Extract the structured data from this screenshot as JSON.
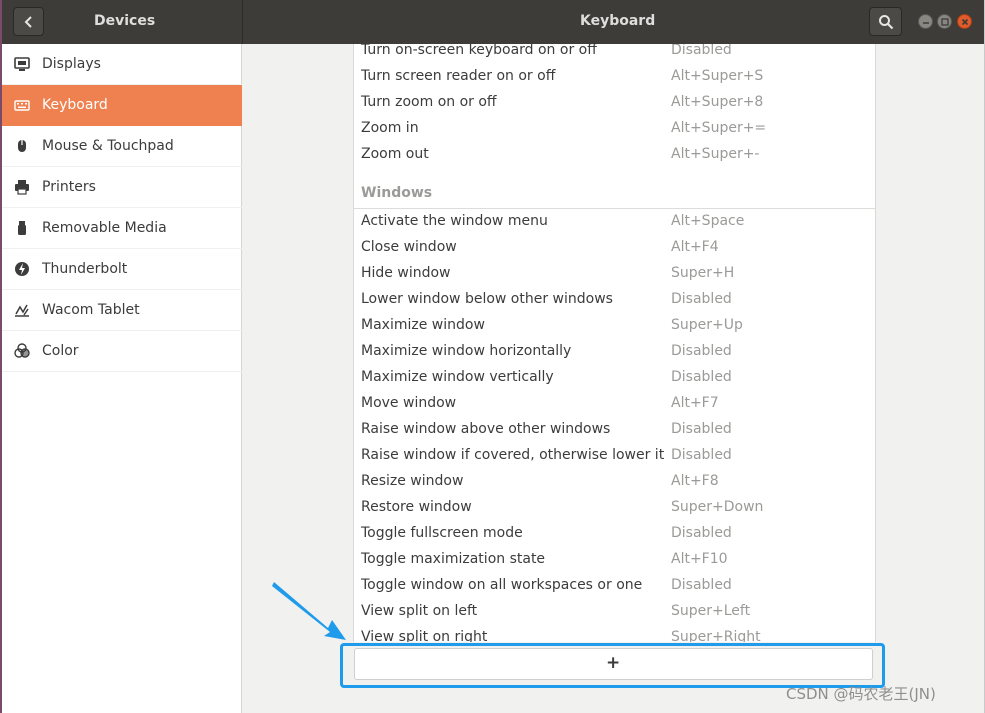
{
  "header": {
    "left_title": "Devices",
    "title": "Keyboard"
  },
  "sidebar": {
    "items": [
      {
        "label": "Displays",
        "icon": "display-icon",
        "active": false
      },
      {
        "label": "Keyboard",
        "icon": "keyboard-icon",
        "active": true
      },
      {
        "label": "Mouse & Touchpad",
        "icon": "mouse-icon",
        "active": false
      },
      {
        "label": "Printers",
        "icon": "printer-icon",
        "active": false
      },
      {
        "label": "Removable Media",
        "icon": "removable-media-icon",
        "active": false
      },
      {
        "label": "Thunderbolt",
        "icon": "thunderbolt-icon",
        "active": false
      },
      {
        "label": "Wacom Tablet",
        "icon": "tablet-icon",
        "active": false
      },
      {
        "label": "Color",
        "icon": "color-icon",
        "active": false
      }
    ]
  },
  "shortcuts": {
    "accessibility_rows": [
      {
        "name": "Turn on-screen keyboard on or off",
        "accel": "Disabled"
      },
      {
        "name": "Turn screen reader on or off",
        "accel": "Alt+Super+S"
      },
      {
        "name": "Turn zoom on or off",
        "accel": "Alt+Super+8"
      },
      {
        "name": "Zoom in",
        "accel": "Alt+Super+="
      },
      {
        "name": "Zoom out",
        "accel": "Alt+Super+-"
      }
    ],
    "windows_heading": "Windows",
    "windows_rows": [
      {
        "name": "Activate the window menu",
        "accel": "Alt+Space"
      },
      {
        "name": "Close window",
        "accel": "Alt+F4"
      },
      {
        "name": "Hide window",
        "accel": "Super+H"
      },
      {
        "name": "Lower window below other windows",
        "accel": "Disabled"
      },
      {
        "name": "Maximize window",
        "accel": "Super+Up"
      },
      {
        "name": "Maximize window horizontally",
        "accel": "Disabled"
      },
      {
        "name": "Maximize window vertically",
        "accel": "Disabled"
      },
      {
        "name": "Move window",
        "accel": "Alt+F7"
      },
      {
        "name": "Raise window above other windows",
        "accel": "Disabled"
      },
      {
        "name": "Raise window if covered, otherwise lower it",
        "accel": "Disabled"
      },
      {
        "name": "Resize window",
        "accel": "Alt+F8"
      },
      {
        "name": "Restore window",
        "accel": "Super+Down"
      },
      {
        "name": "Toggle fullscreen mode",
        "accel": "Disabled"
      },
      {
        "name": "Toggle maximization state",
        "accel": "Alt+F10"
      },
      {
        "name": "Toggle window on all workspaces or one",
        "accel": "Disabled"
      },
      {
        "name": "View split on left",
        "accel": "Super+Left"
      },
      {
        "name": "View split on right",
        "accel": "Super+Right"
      }
    ],
    "add_label": "+"
  },
  "watermark": "CSDN @码农老王(JN)",
  "colors": {
    "accent": "#ef8150",
    "header": "#3d3c38",
    "highlight": "#1f9bec",
    "close": "#e25b2b"
  }
}
